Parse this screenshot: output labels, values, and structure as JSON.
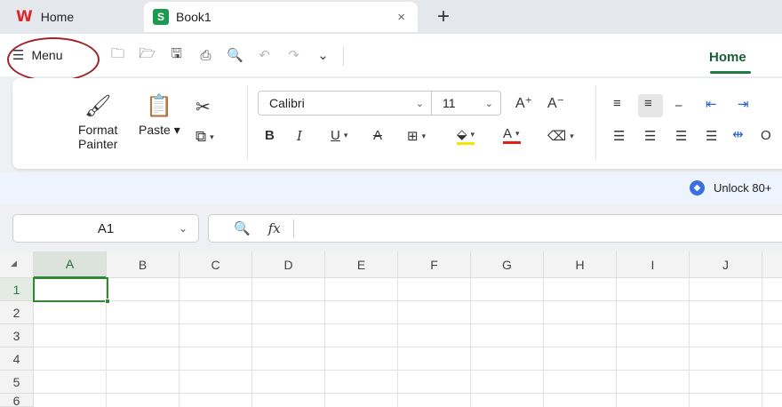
{
  "tabs": [
    {
      "label": "Home",
      "logo": "W"
    },
    {
      "label": "Book1",
      "logo": "S",
      "close": "×"
    }
  ],
  "new_tab": "+",
  "menu": {
    "label": "Menu",
    "icon": "☰"
  },
  "quick_icons": [
    {
      "name": "new-icon",
      "glyph": "🗀"
    },
    {
      "name": "open-icon",
      "glyph": "🗁"
    },
    {
      "name": "save-icon",
      "glyph": "🖫"
    },
    {
      "name": "print-icon",
      "glyph": "⎙"
    },
    {
      "name": "print-preview-icon",
      "glyph": "🔍"
    },
    {
      "name": "undo-icon",
      "glyph": "↶"
    },
    {
      "name": "redo-icon",
      "glyph": "↷"
    },
    {
      "name": "more-icon",
      "glyph": "⌄"
    }
  ],
  "ribbon_tab": "Home",
  "ribbon": {
    "format_painter_line1": "Format",
    "format_painter_line2": "Painter",
    "paste": "Paste",
    "font_name": "Calibri",
    "font_size": "11",
    "grow": "A⁺",
    "shrink": "A⁻",
    "bold": "B",
    "italic": "I",
    "underline": "U",
    "strike": "A",
    "partial_label": "O"
  },
  "banner": {
    "text": "Unlock 80+"
  },
  "formula_bar": {
    "name_box": "A1",
    "fx": "fx"
  },
  "columns": [
    "A",
    "B",
    "C",
    "D",
    "E",
    "F",
    "G",
    "H",
    "I",
    "J"
  ],
  "rows": [
    "1",
    "2",
    "3",
    "4",
    "5",
    "6"
  ],
  "colors": {
    "accent": "#1f7a44",
    "active_cell": "#2f8a2f",
    "menu_circle": "#a0252b"
  }
}
